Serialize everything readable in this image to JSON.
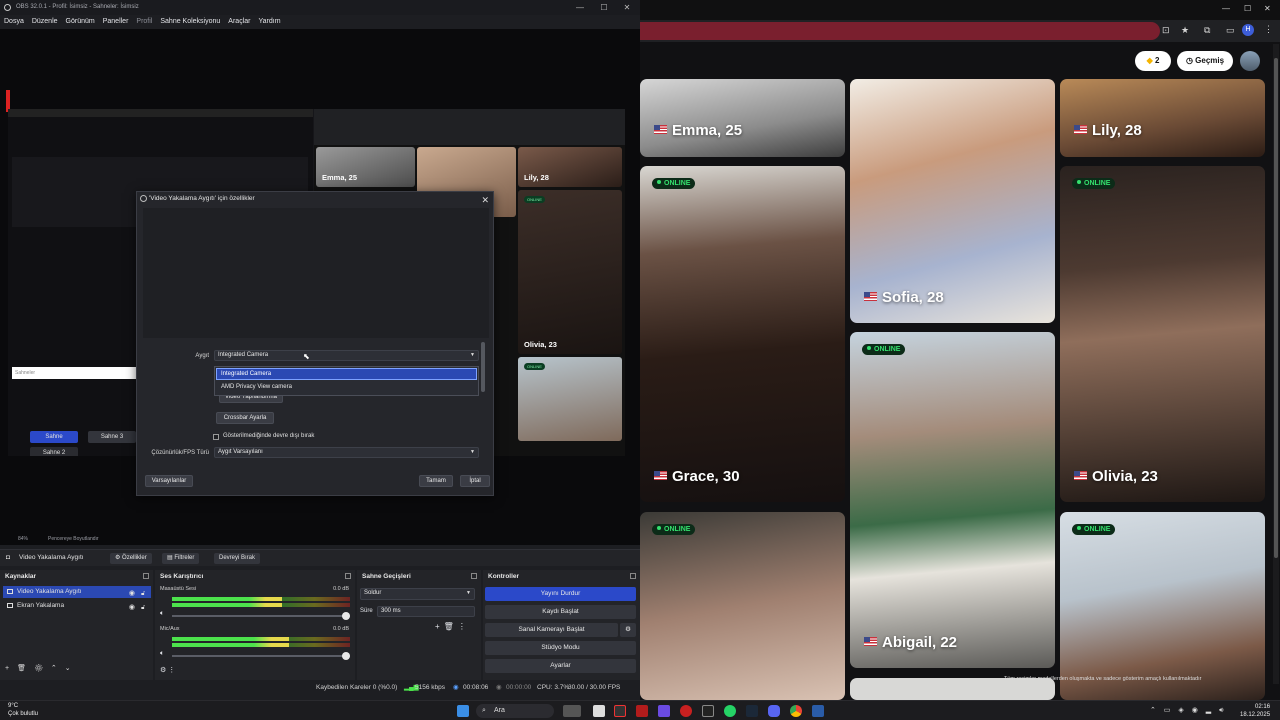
{
  "obs": {
    "title": "OBS 32.0.1 - Profil: İsimsiz - Sahneler: İsimsiz",
    "menu": [
      "Dosya",
      "Düzenle",
      "Görünüm",
      "Paneller",
      "Profil",
      "Sahne Koleksiyonu",
      "Araçlar",
      "Yardım"
    ],
    "zoom": "84%",
    "zoom_label": "Pencereye Boyutlandır",
    "nested_scenes": [
      "Sahne",
      "Sahne 3",
      "Sahne 2"
    ],
    "nested_scenes_header": "Sahneler",
    "dialog": {
      "title": "'Video Yakalama Aygıtı' için özellikler",
      "device_label": "Aygıt",
      "device_value": "Integrated Camera",
      "options": [
        "Integrated Camera",
        "AMD Privacy View camera"
      ],
      "configure_video": "Video Yapılandırma",
      "crossbar": "Crossbar Ayarla",
      "deactivate_label": "Gösterilmediğinde devre dışı bırak",
      "fps_label": "Çözünürlük/FPS Türü",
      "fps_value": "Aygıt Varsayılanı",
      "defaults": "Varsayılanlar",
      "ok": "Tamam",
      "cancel": "İptal"
    },
    "context": {
      "source": "Video Yakalama Aygıtı",
      "properties": "Özellikler",
      "filters": "Filtreler",
      "deactivate": "Devreyi Bırak"
    },
    "sources": {
      "header": "Kaynaklar",
      "items": [
        "Video Yakalama Aygıtı",
        "Ekran Yakalama"
      ]
    },
    "mixer": {
      "header": "Ses Karıştırıcı",
      "channels": [
        {
          "name": "Masaüstü Sesi",
          "db": "0.0 dB",
          "level": 0.62
        },
        {
          "name": "Mic/Aux",
          "db": "0.0 dB",
          "level": 0.66
        }
      ]
    },
    "transitions": {
      "header": "Sahne Geçişleri",
      "type": "Soldur",
      "duration_label": "Süre",
      "duration": "300 ms"
    },
    "controls": {
      "header": "Kontroller",
      "buttons": [
        "Yayını Durdur",
        "Kaydı Başlat",
        "Sanal Kamerayı Başlat",
        "Stüdyo Modu",
        "Ayarlar"
      ]
    },
    "status": {
      "dropped": "Kaybedilen Kareler 0 (%0.0)",
      "bitrate": "5156 kbps",
      "live_time": "00:08:06",
      "rec_time": "00:00:00",
      "cpu": "CPU: 3.7%",
      "fps": "30.00 / 30.00 FPS"
    }
  },
  "browser": {
    "coins": "2",
    "history": "Geçmiş",
    "online_label": "ONLINE",
    "profiles": [
      {
        "name": "Emma, 25"
      },
      {
        "name": "Lily, 28"
      },
      {
        "name": "Sofia, 28"
      },
      {
        "name": "Grace, 30"
      },
      {
        "name": "Olivia, 23"
      },
      {
        "name": "Abigail, 22"
      }
    ],
    "mini_profiles": [
      "Emma, 25",
      "Lily, 28",
      "Olivia, 23"
    ],
    "footer_note": "Tüm resimler modellerden oluşmakta ve sadece gösterim amaçlı kullanılmaktadır"
  },
  "taskbar": {
    "temp": "9°C",
    "weather": "Çok bulutlu",
    "search": "Ara",
    "time": "02:16",
    "date": "18.12.2025"
  }
}
